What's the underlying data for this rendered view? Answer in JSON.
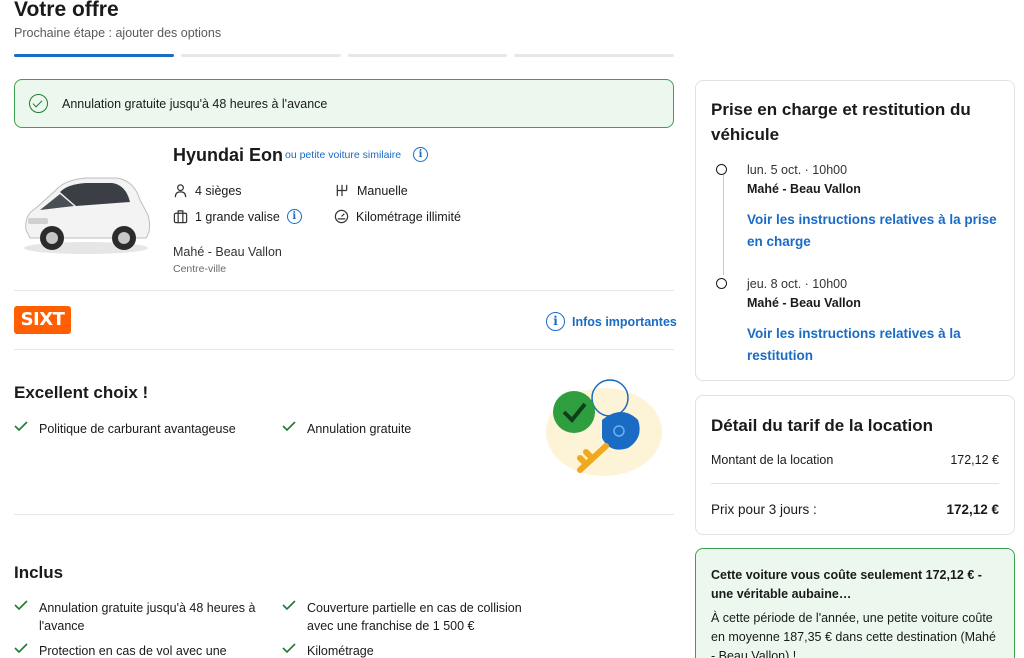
{
  "header": {
    "title": "Votre offre",
    "subtitle": "Prochaine étape : ajouter des options",
    "progress_steps": 4,
    "progress_active": 1
  },
  "banner": {
    "text": "Annulation gratuite jusqu'à 48 heures à l'avance"
  },
  "car": {
    "name": "Hyundai Eon",
    "similar_label": "ou petite voiture similaire",
    "seats": "4 sièges",
    "transmission": "Manuelle",
    "luggage": "1 grande valise",
    "mileage": "Kilométrage illimité",
    "location": "Mahé - Beau Vallon",
    "location_sub": "Centre-ville"
  },
  "supplier": {
    "logo_text": "SIXT",
    "info_link": "Infos importantes"
  },
  "excellent": {
    "title": "Excellent choix !",
    "items": [
      "Politique de carburant avantageuse",
      "Annulation gratuite"
    ]
  },
  "included": {
    "title": "Inclus",
    "items": [
      "Annulation gratuite jusqu'à 48 heures à l'avance",
      "Couverture partielle en cas de collision avec une franchise de 1 500 €",
      "Protection en cas de vol avec une",
      "Kilométrage"
    ]
  },
  "pickup": {
    "title": "Prise en charge et restitution du véhicule",
    "pickup_date": "lun. 5 oct. · 10h00",
    "pickup_place": "Mahé - Beau Vallon",
    "pickup_link": "Voir les instructions relatives à la prise en charge",
    "return_date": "jeu. 8 oct. · 10h00",
    "return_place": "Mahé - Beau Vallon",
    "return_link": "Voir les instructions relatives à la restitution"
  },
  "price": {
    "title": "Détail du tarif de la location",
    "rental_label": "Montant de la location",
    "rental_value": "172,12 €",
    "total_label": "Prix pour 3 jours :",
    "total_value": "172,12 €"
  },
  "deal": {
    "title": "Cette voiture vous coûte seulement 172,12 € - une véritable aubaine…",
    "body": "À cette période de l'année, une petite voiture coûte en moyenne 187,35 € dans cette destination (Mahé - Beau Vallon) !"
  },
  "colors": {
    "accent": "#1a6bc4",
    "success": "#1f7a34",
    "success_bg": "#ecf8ee",
    "brand_sixt": "#ff5f00"
  }
}
